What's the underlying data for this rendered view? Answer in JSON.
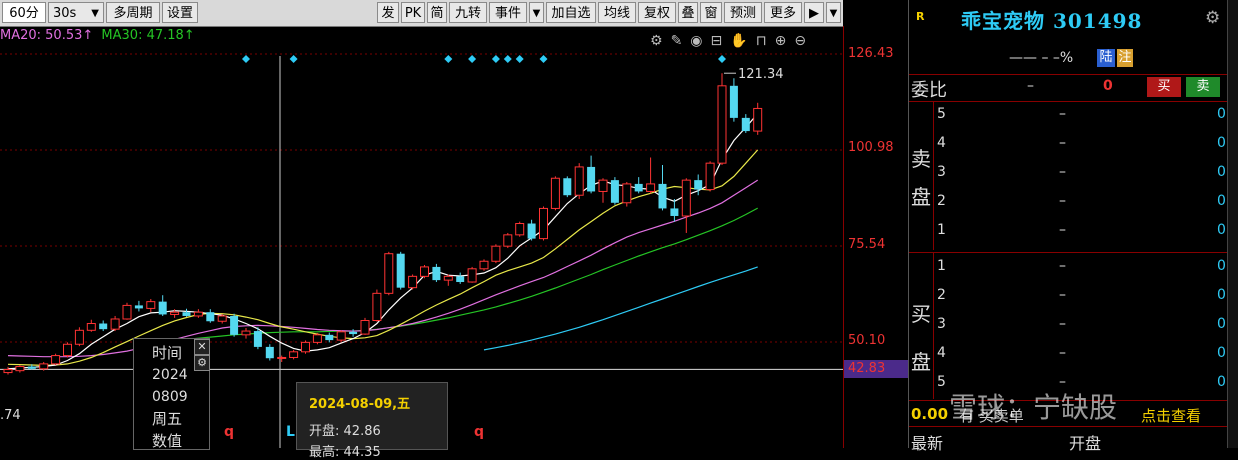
{
  "toolbar": {
    "period": "60分",
    "refresh": "30s",
    "multi_period": "多周期",
    "settings": "设置",
    "right_items": [
      "发",
      "PK",
      "简",
      "九转",
      "事件",
      "加自选",
      "均线",
      "复权",
      "叠",
      "窗",
      "预测",
      "更多"
    ]
  },
  "ma": {
    "ma20": "MA20: 50.53↑",
    "ma30": "MA30: 47.18↑"
  },
  "y_axis": {
    "labels": [
      "126.43",
      "100.98",
      "75.54",
      "50.10"
    ],
    "current_price": "42.83",
    "high_annotation": "121.34",
    "left_partial": ".74"
  },
  "markers": {
    "q_label": "q",
    "l_label": "L"
  },
  "datebox": [
    "时间",
    "2024",
    "0809",
    "周五",
    "数值"
  ],
  "tooltip": {
    "date": "2024-08-09,五",
    "open_label": "开盘:",
    "open_value": "42.86",
    "high_partial": "最高: 44.35"
  },
  "panel": {
    "badge": "R",
    "name": "乖宝宠物 301498",
    "price_row": "—— – –%",
    "tag_lu": "陆",
    "tag_zhu": "注",
    "weibi_label": "委比",
    "weibi_dash": "–",
    "weibi_value": "0",
    "buy_btn": "买",
    "sell_btn": "卖",
    "sell_label": [
      "卖",
      "盘"
    ],
    "buy_label": [
      "买",
      "盘"
    ],
    "sell_levels": [
      "5",
      "4",
      "3",
      "2",
      "1"
    ],
    "buy_levels": [
      "1",
      "2",
      "3",
      "4",
      "5"
    ],
    "dash": "–",
    "zero": "0",
    "bottom_left": "0.00",
    "bottom_text": "有    买卖单",
    "bottom_click": "点击查看",
    "last_row_left": "最新",
    "last_row_mid": "开盘",
    "watermark": "雪球：宁缺股"
  },
  "colors": {
    "up": "#ff3333",
    "down": "#54d8f0",
    "ma5": "#ffffff",
    "ma10": "#e8e84a",
    "ma20": "#e070e0",
    "ma30": "#25c425",
    "ma60": "#2ecbf5"
  },
  "candles": [
    [
      42.0,
      43.5,
      41.5,
      42.8
    ],
    [
      42.5,
      44.0,
      42.0,
      43.6
    ],
    [
      43.6,
      44.2,
      42.8,
      43.0
    ],
    [
      43.0,
      44.8,
      42.5,
      44.3
    ],
    [
      44.3,
      47.0,
      44.0,
      46.5
    ],
    [
      46.5,
      50.0,
      46.0,
      49.5
    ],
    [
      49.5,
      54.0,
      49.0,
      53.2
    ],
    [
      53.2,
      56.0,
      52.8,
      55.0
    ],
    [
      55.0,
      55.8,
      53.0,
      53.5
    ],
    [
      53.5,
      57.0,
      53.0,
      56.2
    ],
    [
      56.2,
      60.5,
      56.0,
      59.8
    ],
    [
      59.8,
      61.0,
      58.2,
      59.0
    ],
    [
      59.0,
      61.5,
      58.0,
      60.8
    ],
    [
      60.8,
      62.5,
      57.0,
      57.4
    ],
    [
      57.4,
      58.8,
      56.5,
      58.0
    ],
    [
      58.0,
      58.9,
      56.8,
      57.0
    ],
    [
      57.0,
      58.8,
      56.5,
      58.0
    ],
    [
      58.0,
      58.8,
      55.2,
      55.6
    ],
    [
      55.6,
      57.5,
      55.0,
      57.0
    ],
    [
      57.0,
      57.6,
      51.5,
      52.0
    ],
    [
      52.0,
      53.8,
      51.0,
      53.0
    ],
    [
      53.0,
      54.0,
      48.2,
      48.8
    ],
    [
      48.8,
      49.5,
      45.2,
      45.8
    ],
    [
      45.8,
      46.5,
      44.8,
      46.0
    ],
    [
      46.0,
      48.0,
      45.5,
      47.5
    ],
    [
      47.5,
      50.5,
      47.0,
      50.0
    ],
    [
      50.0,
      52.5,
      49.5,
      52.0
    ],
    [
      52.0,
      52.6,
      50.0,
      50.6
    ],
    [
      50.6,
      53.2,
      50.2,
      52.8
    ],
    [
      52.8,
      53.5,
      51.5,
      52.2
    ],
    [
      52.2,
      56.5,
      52.0,
      55.8
    ],
    [
      55.8,
      64.0,
      55.5,
      63.0
    ],
    [
      63.0,
      74.0,
      62.5,
      73.5
    ],
    [
      73.5,
      74.0,
      64.0,
      64.5
    ],
    [
      64.5,
      68.0,
      64.0,
      67.5
    ],
    [
      67.5,
      70.5,
      67.0,
      70.0
    ],
    [
      70.0,
      70.8,
      66.0,
      66.5
    ],
    [
      66.5,
      68.0,
      65.0,
      67.5
    ],
    [
      67.5,
      68.5,
      65.5,
      66.0
    ],
    [
      66.0,
      70.0,
      65.8,
      69.5
    ],
    [
      69.5,
      72.0,
      69.0,
      71.5
    ],
    [
      71.5,
      76.0,
      71.0,
      75.5
    ],
    [
      75.5,
      79.0,
      75.0,
      78.5
    ],
    [
      78.5,
      82.0,
      78.0,
      81.5
    ],
    [
      81.5,
      82.5,
      77.0,
      77.5
    ],
    [
      77.5,
      86.0,
      77.0,
      85.5
    ],
    [
      85.5,
      94.0,
      85.0,
      93.5
    ],
    [
      93.5,
      94.0,
      88.5,
      89.0
    ],
    [
      89.0,
      97.5,
      88.0,
      96.5
    ],
    [
      96.5,
      99.5,
      89.5,
      90.0
    ],
    [
      90.0,
      93.5,
      87.0,
      93.0
    ],
    [
      93.0,
      93.8,
      86.5,
      87.0
    ],
    [
      87.0,
      92.5,
      86.0,
      92.0
    ],
    [
      92.0,
      93.8,
      89.5,
      90.0
    ],
    [
      90.0,
      99.0,
      89.5,
      92.0
    ],
    [
      92.0,
      97.0,
      85.0,
      85.5
    ],
    [
      85.5,
      88.0,
      82.0,
      83.5
    ],
    [
      83.5,
      93.5,
      79.0,
      93.0
    ],
    [
      93.0,
      94.5,
      89.0,
      90.5
    ],
    [
      90.5,
      98.0,
      90.0,
      97.5
    ],
    [
      97.5,
      121.34,
      97.0,
      118.0
    ],
    [
      118.0,
      120.0,
      108.5,
      109.5
    ],
    [
      109.5,
      110.5,
      105.5,
      106.0
    ],
    [
      106.0,
      113.5,
      105.0,
      112.0
    ]
  ],
  "ma_series": {
    "ma5": [
      43.0,
      43.2,
      43.4,
      43.6,
      44.0,
      45.2,
      47.0,
      49.5,
      51.5,
      53.5,
      55.0,
      56.8,
      57.8,
      58.0,
      58.4,
      58.2,
      58.0,
      57.6,
      57.2,
      56.2,
      55.0,
      53.6,
      51.6,
      49.8,
      48.4,
      47.7,
      48.0,
      48.6,
      49.8,
      51.0,
      52.6,
      55.0,
      58.6,
      61.8,
      64.4,
      67.8,
      68.8,
      67.8,
      67.6,
      67.9,
      68.4,
      69.8,
      72.3,
      75.6,
      77.7,
      79.8,
      83.3,
      86.8,
      89.4,
      91.6,
      92.8,
      91.8,
      91.5,
      90.8,
      90.6,
      88.5,
      87.4,
      89.0,
      90.2,
      91.8,
      98.5,
      103.5,
      107.0,
      110.6
    ],
    "ma10": [
      44.2,
      44.1,
      44.0,
      43.9,
      44.0,
      44.3,
      45.0,
      46.0,
      47.3,
      48.8,
      50.2,
      51.7,
      53.1,
      54.5,
      55.7,
      56.6,
      57.4,
      57.7,
      57.6,
      57.3,
      56.7,
      56.0,
      55.0,
      54.1,
      53.5,
      52.8,
      52.2,
      51.6,
      51.2,
      51.0,
      51.2,
      51.8,
      53.2,
      54.8,
      56.5,
      58.3,
      59.9,
      61.4,
      62.8,
      64.5,
      66.1,
      67.8,
      69.0,
      70.0,
      71.0,
      72.5,
      74.8,
      77.3,
      79.8,
      82.0,
      84.2,
      86.2,
      87.5,
      88.6,
      89.5,
      90.6,
      91.3,
      91.0,
      90.6,
      90.4,
      91.5,
      94.0,
      97.5,
      101.0
    ],
    "ma20": [
      46.5,
      46.4,
      46.3,
      46.2,
      46.2,
      46.2,
      46.3,
      46.5,
      46.8,
      47.2,
      47.7,
      48.4,
      49.2,
      50.0,
      50.8,
      51.6,
      52.4,
      53.1,
      53.8,
      54.2,
      54.4,
      54.5,
      54.4,
      54.2,
      54.0,
      53.7,
      53.4,
      53.2,
      53.1,
      53.0,
      53.1,
      53.4,
      53.9,
      54.4,
      55.0,
      55.8,
      56.7,
      57.7,
      58.8,
      60.0,
      61.3,
      62.6,
      63.8,
      65.0,
      66.1,
      67.2,
      68.6,
      70.1,
      71.6,
      73.1,
      74.8,
      76.4,
      77.9,
      79.1,
      80.1,
      81.1,
      82.1,
      83.2,
      84.3,
      85.5,
      87.0,
      89.0,
      91.0,
      93.0
    ],
    "ma30": [
      null,
      null,
      null,
      null,
      null,
      null,
      null,
      null,
      null,
      null,
      null,
      null,
      null,
      null,
      50.5,
      50.8,
      51.1,
      51.4,
      51.7,
      52.0,
      52.2,
      52.4,
      52.6,
      52.7,
      52.8,
      52.8,
      52.8,
      52.9,
      53.0,
      53.0,
      53.2,
      53.5,
      53.9,
      54.3,
      54.8,
      55.3,
      55.9,
      56.5,
      57.2,
      57.9,
      58.6,
      59.4,
      60.3,
      61.2,
      62.2,
      63.3,
      64.4,
      65.6,
      66.8,
      68.0,
      69.3,
      70.5,
      71.7,
      72.9,
      74.0,
      75.1,
      76.1,
      77.2,
      78.4,
      79.6,
      80.9,
      82.3,
      83.9,
      85.6
    ],
    "ma60": [
      null,
      null,
      null,
      null,
      null,
      null,
      null,
      null,
      null,
      null,
      null,
      null,
      null,
      null,
      null,
      null,
      null,
      null,
      null,
      null,
      null,
      null,
      null,
      null,
      null,
      null,
      null,
      null,
      null,
      null,
      null,
      null,
      null,
      null,
      null,
      null,
      null,
      null,
      null,
      null,
      48.0,
      48.6,
      49.2,
      49.9,
      50.6,
      51.4,
      52.2,
      53.1,
      54.0,
      55.0,
      56.0,
      57.1,
      58.2,
      59.3,
      60.4,
      61.5,
      62.6,
      63.7,
      64.8,
      65.9,
      66.9,
      67.9,
      68.9,
      70.0
    ]
  },
  "event_markers": [
    20,
    24,
    37,
    39,
    41,
    42,
    43,
    45,
    60
  ]
}
